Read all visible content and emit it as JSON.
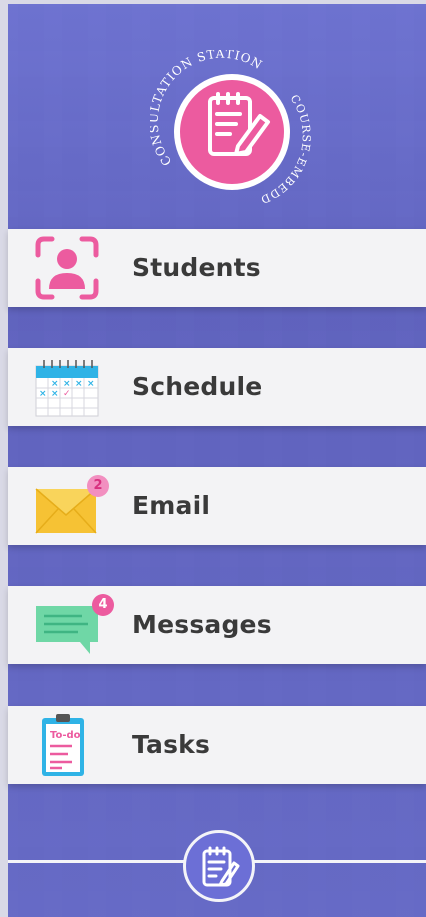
{
  "logo": {
    "arc_left": "CONSULTATION STATION",
    "arc_right": "COURSE-EMBEDDED"
  },
  "menu": {
    "items": [
      {
        "label": "Students",
        "icon": "students-icon"
      },
      {
        "label": "Schedule",
        "icon": "calendar-icon"
      },
      {
        "label": "Email",
        "icon": "envelope-icon",
        "badge": "2"
      },
      {
        "label": "Messages",
        "icon": "chat-icon",
        "badge": "4"
      },
      {
        "label": "Tasks",
        "icon": "todo-clipboard-icon",
        "caption": "To-do"
      }
    ]
  },
  "colors": {
    "accent_pink": "#ec5b9f",
    "row_bg": "#f3f3f5",
    "bg_purple": "#6f74c9"
  }
}
